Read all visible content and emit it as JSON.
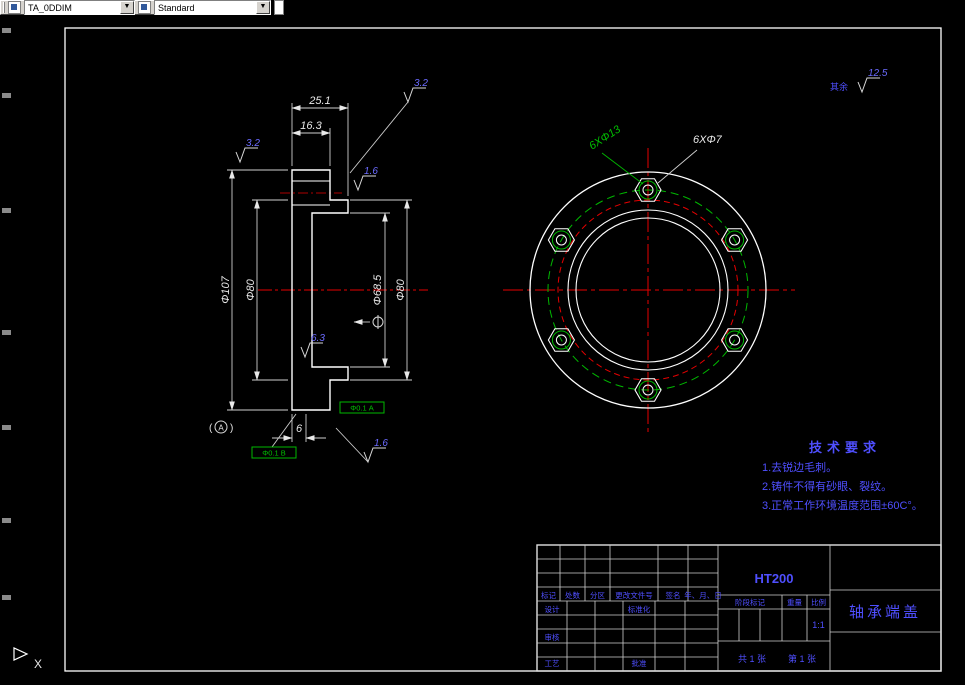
{
  "toolbar": {
    "layer_value": "TA_0DDIM",
    "style_value": "Standard",
    "dropdown_glyph": "▼"
  },
  "general_roughness": {
    "prefix": "其余",
    "value": "12.5"
  },
  "section_view": {
    "dim_total_width": "25.1",
    "dim_flange_width": "16.3",
    "dim_outer_dia": "Φ107",
    "dim_left_dia": "Φ80",
    "dim_bore_dia": "Φ68.5",
    "dim_right_dia": "Φ80",
    "dim_step": "6",
    "roughness_top": "3.2",
    "roughness_left": "3.2",
    "roughness_bore": "1.6",
    "roughness_inner": "6.3",
    "roughness_bottom": "1.6",
    "gdt_frame_1": "Φ0.1 A",
    "gdt_frame_2": "Φ0.1 B",
    "datum_label": "A",
    "datum_open": "(",
    "datum_close": ")"
  },
  "front_view": {
    "counterbore_label": "6XΦ13",
    "hole_label": "6XΦ7"
  },
  "tech_requirements": {
    "title": "技术要求",
    "items": [
      "1.去锐边毛刺。",
      "2.铸件不得有砂眼、裂纹。",
      "3.正常工作环境温度范围±60C°。"
    ]
  },
  "title_block": {
    "material": "HT200",
    "part_name": "轴承端盖",
    "rev_labels": [
      "标记",
      "处数",
      "分区",
      "更改文件号",
      "签名",
      "年、月、日"
    ],
    "design_label": "设计",
    "standard_label": "标准化",
    "review_label": "审核",
    "craft_label": "工艺",
    "approve_label": "批准",
    "stage_label": "阶段标记",
    "weight_label": "重量",
    "scale_label": "比例",
    "scale_value": "1:1",
    "sheet_total": "共 1 张",
    "sheet_no": "第 1 张"
  },
  "ucs": {
    "x_label": "X"
  }
}
